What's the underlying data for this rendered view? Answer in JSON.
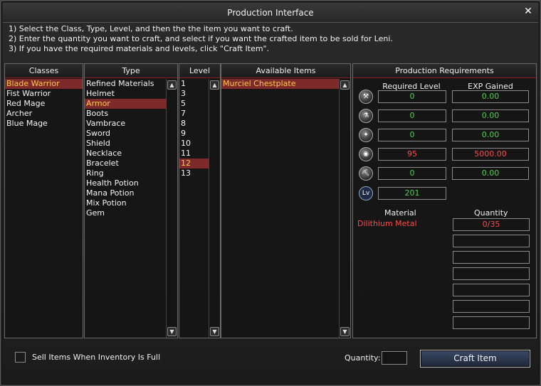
{
  "window": {
    "title": "Production Interface",
    "close_icon": "close-icon"
  },
  "instructions": [
    "1) Select the Class, Type, Level, and then the the item you want to craft.",
    "2) Enter the quantity you want to craft, and select if you want the crafted item to be sold for Leni.",
    "3) If you have the required materials and levels, click \"Craft Item\"."
  ],
  "classes": {
    "header": "Classes",
    "items": [
      "Blade Warrior",
      "Fist Warrior",
      "Red Mage",
      "Archer",
      "Blue Mage"
    ],
    "selected_index": 0
  },
  "type": {
    "header": "Type",
    "items": [
      "Refined Materials",
      "Helmet",
      "Armor",
      "Boots",
      "Vambrace",
      "Sword",
      "Shield",
      "Necklace",
      "Bracelet",
      "Ring",
      "Health Potion",
      "Mana Potion",
      "Mix Potion",
      "Gem"
    ],
    "selected_index": 2
  },
  "level": {
    "header": "Level",
    "items": [
      "1",
      "3",
      "5",
      "7",
      "8",
      "9",
      "10",
      "11",
      "12",
      "13"
    ],
    "selected_index": 8
  },
  "available": {
    "header": "Available Items",
    "items": [
      "Murciel Chestplate"
    ],
    "selected_index": 0
  },
  "requirements": {
    "header": "Production Requirements",
    "col_required": "Required Level",
    "col_exp": "EXP Gained",
    "rows": [
      {
        "icon": "crafting-skill-icon-1",
        "required": "0",
        "exp": "0.00",
        "status": "ok"
      },
      {
        "icon": "crafting-skill-icon-2",
        "required": "0",
        "exp": "0.00",
        "status": "ok"
      },
      {
        "icon": "crafting-skill-icon-3",
        "required": "0",
        "exp": "0.00",
        "status": "ok"
      },
      {
        "icon": "crafting-skill-icon-4",
        "required": "95",
        "exp": "5000.00",
        "status": "fail"
      },
      {
        "icon": "crafting-skill-icon-5",
        "required": "0",
        "exp": "0.00",
        "status": "ok"
      }
    ],
    "level_row": {
      "icon_text": "Lv",
      "value": "201"
    },
    "material_header": "Material",
    "quantity_header": "Quantity",
    "materials": [
      {
        "name": "Dilithium Metal",
        "qty": "0/35"
      },
      {
        "name": "",
        "qty": ""
      },
      {
        "name": "",
        "qty": ""
      },
      {
        "name": "",
        "qty": ""
      },
      {
        "name": "",
        "qty": ""
      },
      {
        "name": "",
        "qty": ""
      },
      {
        "name": "",
        "qty": ""
      }
    ]
  },
  "footer": {
    "sell_label": "Sell Items When Inventory Is Full",
    "sell_checked": false,
    "quantity_label": "Quantity:",
    "quantity_value": "",
    "craft_label": "Craft Item"
  },
  "colors": {
    "selected_bg": "#7e2a2a",
    "selected_text": "#ffc84a",
    "ok": "#4bd24b",
    "fail": "#ff4a4a",
    "divider": "#8a2020"
  }
}
